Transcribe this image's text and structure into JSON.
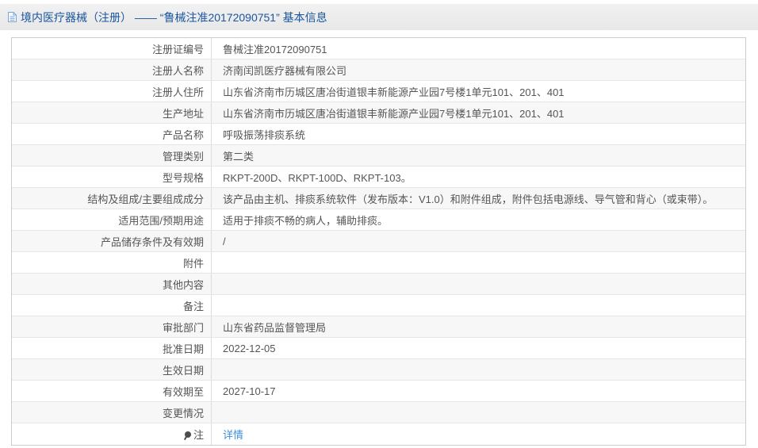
{
  "header": {
    "icon": "document-icon",
    "title": "境内医疗器械（注册） —— “鲁械注准20172090751” 基本信息"
  },
  "table": {
    "rows": [
      {
        "label": "注册证编号",
        "value": "鲁械注准20172090751"
      },
      {
        "label": "注册人名称",
        "value": "济南闰凯医疗器械有限公司"
      },
      {
        "label": "注册人住所",
        "value": "山东省济南市历城区唐冶街道银丰新能源产业园7号楼1单元101、201、401"
      },
      {
        "label": "生产地址",
        "value": "山东省济南市历城区唐冶街道银丰新能源产业园7号楼1单元101、201、401"
      },
      {
        "label": "产品名称",
        "value": "呼吸振荡排痰系统"
      },
      {
        "label": "管理类别",
        "value": "第二类"
      },
      {
        "label": "型号规格",
        "value": "RKPT-200D、RKPT-100D、RKPT-103。"
      },
      {
        "label": "结构及组成/主要组成成分",
        "value": "该产品由主机、排痰系统软件（发布版本：V1.0）和附件组成，附件包括电源线、导气管和背心（或束带）。"
      },
      {
        "label": "适用范围/预期用途",
        "value": "适用于排痰不畅的病人，辅助排痰。"
      },
      {
        "label": "产品储存条件及有效期",
        "value": "/"
      },
      {
        "label": "附件",
        "value": ""
      },
      {
        "label": "其他内容",
        "value": ""
      },
      {
        "label": "备注",
        "value": ""
      },
      {
        "label": "审批部门",
        "value": "山东省药品监督管理局"
      },
      {
        "label": "批准日期",
        "value": "2022-12-05"
      },
      {
        "label": "生效日期",
        "value": ""
      },
      {
        "label": "有效期至",
        "value": "2027-10-17"
      },
      {
        "label": "变更情况",
        "value": ""
      },
      {
        "label": "注",
        "value": "详情",
        "icon": "pin-icon",
        "link": true
      }
    ]
  },
  "colors": {
    "title_blue": "#1a55a0",
    "link_blue": "#3f8fdd",
    "header_band_bg": "#e9e9e9",
    "row_alt_bg": "#f7f7f7",
    "text_gray": "#555555",
    "table_border": "#cccccc"
  }
}
